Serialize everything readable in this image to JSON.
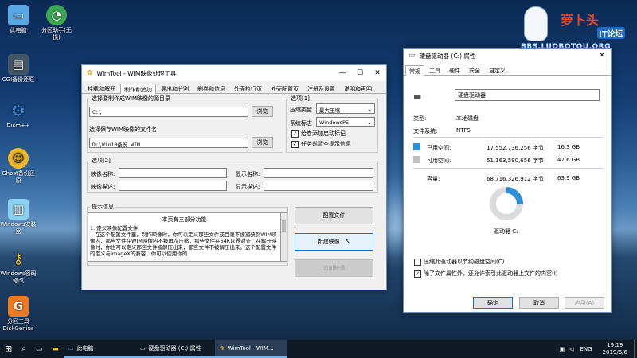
{
  "desktop": {
    "icons": [
      {
        "label": "此电脑",
        "icon": "computer-icon"
      },
      {
        "label": "分区助手(无损)",
        "icon": "partition-assistant-icon"
      },
      {
        "label": "CGI备份还原",
        "icon": "cgi-backup-icon"
      },
      {
        "label": "Dism++",
        "icon": "dism-gear-icon"
      },
      {
        "label": "Ghost备份还原",
        "icon": "ghost-icon"
      },
      {
        "label": "Windows安装器",
        "icon": "windows-installer-icon"
      },
      {
        "label": "Windows密码修改",
        "icon": "key-icon"
      },
      {
        "label": "分区工具DiskGenius",
        "icon": "diskgenius-icon"
      }
    ],
    "logo": {
      "title": "萝卜头",
      "badge": "IT论坛",
      "url": "BBS.LUOBOTOU.ORG"
    }
  },
  "wimtool": {
    "title": "WimTool - WIM映像处理工具",
    "tabs": [
      "挂载和解开",
      "制作和追加",
      "导出和分割",
      "删卷和信息",
      "外壳执行页",
      "外壳配置页",
      "注册及设置",
      "说明和声明"
    ],
    "active_tab": "制作和追加",
    "source_label": "选择要制作成WIM映像的源目录",
    "source_value": "C:\\",
    "browse_label": "浏览",
    "save_label": "选择保存WIM映像的文件名",
    "save_value": "D:\\Win10备份.WIM",
    "options1": {
      "title": "选项[1]",
      "compress_label": "压缩类型",
      "compress_value": "最大压缩",
      "system_label": "系统标志",
      "system_value": "WindowsPE",
      "check_boot": "给卷添加启动标记",
      "check_clear": "任务前清空提示信息"
    },
    "options2": {
      "title": "选项[2]",
      "image_name": "映像名称:",
      "image_desc": "映像描述:",
      "display_name": "显示名称:",
      "display_desc": "显示描述:"
    },
    "info": {
      "title": "提示信息",
      "heading": "本页有三部分功能",
      "body": "1. 定义映像配置文件\n   在这个配置文件里，制作映像时，你可以定义那些文件或目录不被捕获到WIM映像内，那些文件在WIM映像内不被再次压缩，那些文件在64K以界对齐；在解开映像时，你也可以定义那些文件被解压出来，那些文件不被解压出来。这个配置文件的定义与ImageX的兼容，你可以使用你的"
    },
    "buttons": {
      "config": "配置文件",
      "new_image": "新建映像",
      "append": "追加映像"
    }
  },
  "props": {
    "title": "硬盘驱动器 (C:) 属性",
    "tabs": [
      "常规",
      "工具",
      "硬件",
      "安全",
      "自定义"
    ],
    "active_tab": "常规",
    "name": "硬盘驱动器",
    "type_label": "类型:",
    "type_value": "本地磁盘",
    "fs_label": "文件系统:",
    "fs_value": "NTFS",
    "used_label": "已用空间:",
    "used_bytes": "17,552,736,256 字节",
    "used_gb": "16.3 GB",
    "free_label": "可用空间:",
    "free_bytes": "51,163,590,656 字节",
    "free_gb": "47.6 GB",
    "cap_label": "容量:",
    "cap_bytes": "68,716,326,912 字节",
    "cap_gb": "63.9 GB",
    "drive_label": "驱动器 C:",
    "used_fraction": 0.255,
    "check_compress": "压缩此驱动器以节约磁盘空间(C)",
    "check_index": "除了文件属性外，还允许索引此驱动器上文件的内容(I)",
    "ok": "确定",
    "cancel": "取消",
    "apply": "应用(A)",
    "colors": {
      "used": "#2b8fd9",
      "free": "#dcdcdc"
    }
  },
  "taskbar": {
    "items": [
      "此电脑",
      "硬盘驱动器 (C:) 属性",
      "WimTool - WIM..."
    ],
    "lang": "ENG",
    "time": "19:19",
    "date": "2019/6/6"
  }
}
